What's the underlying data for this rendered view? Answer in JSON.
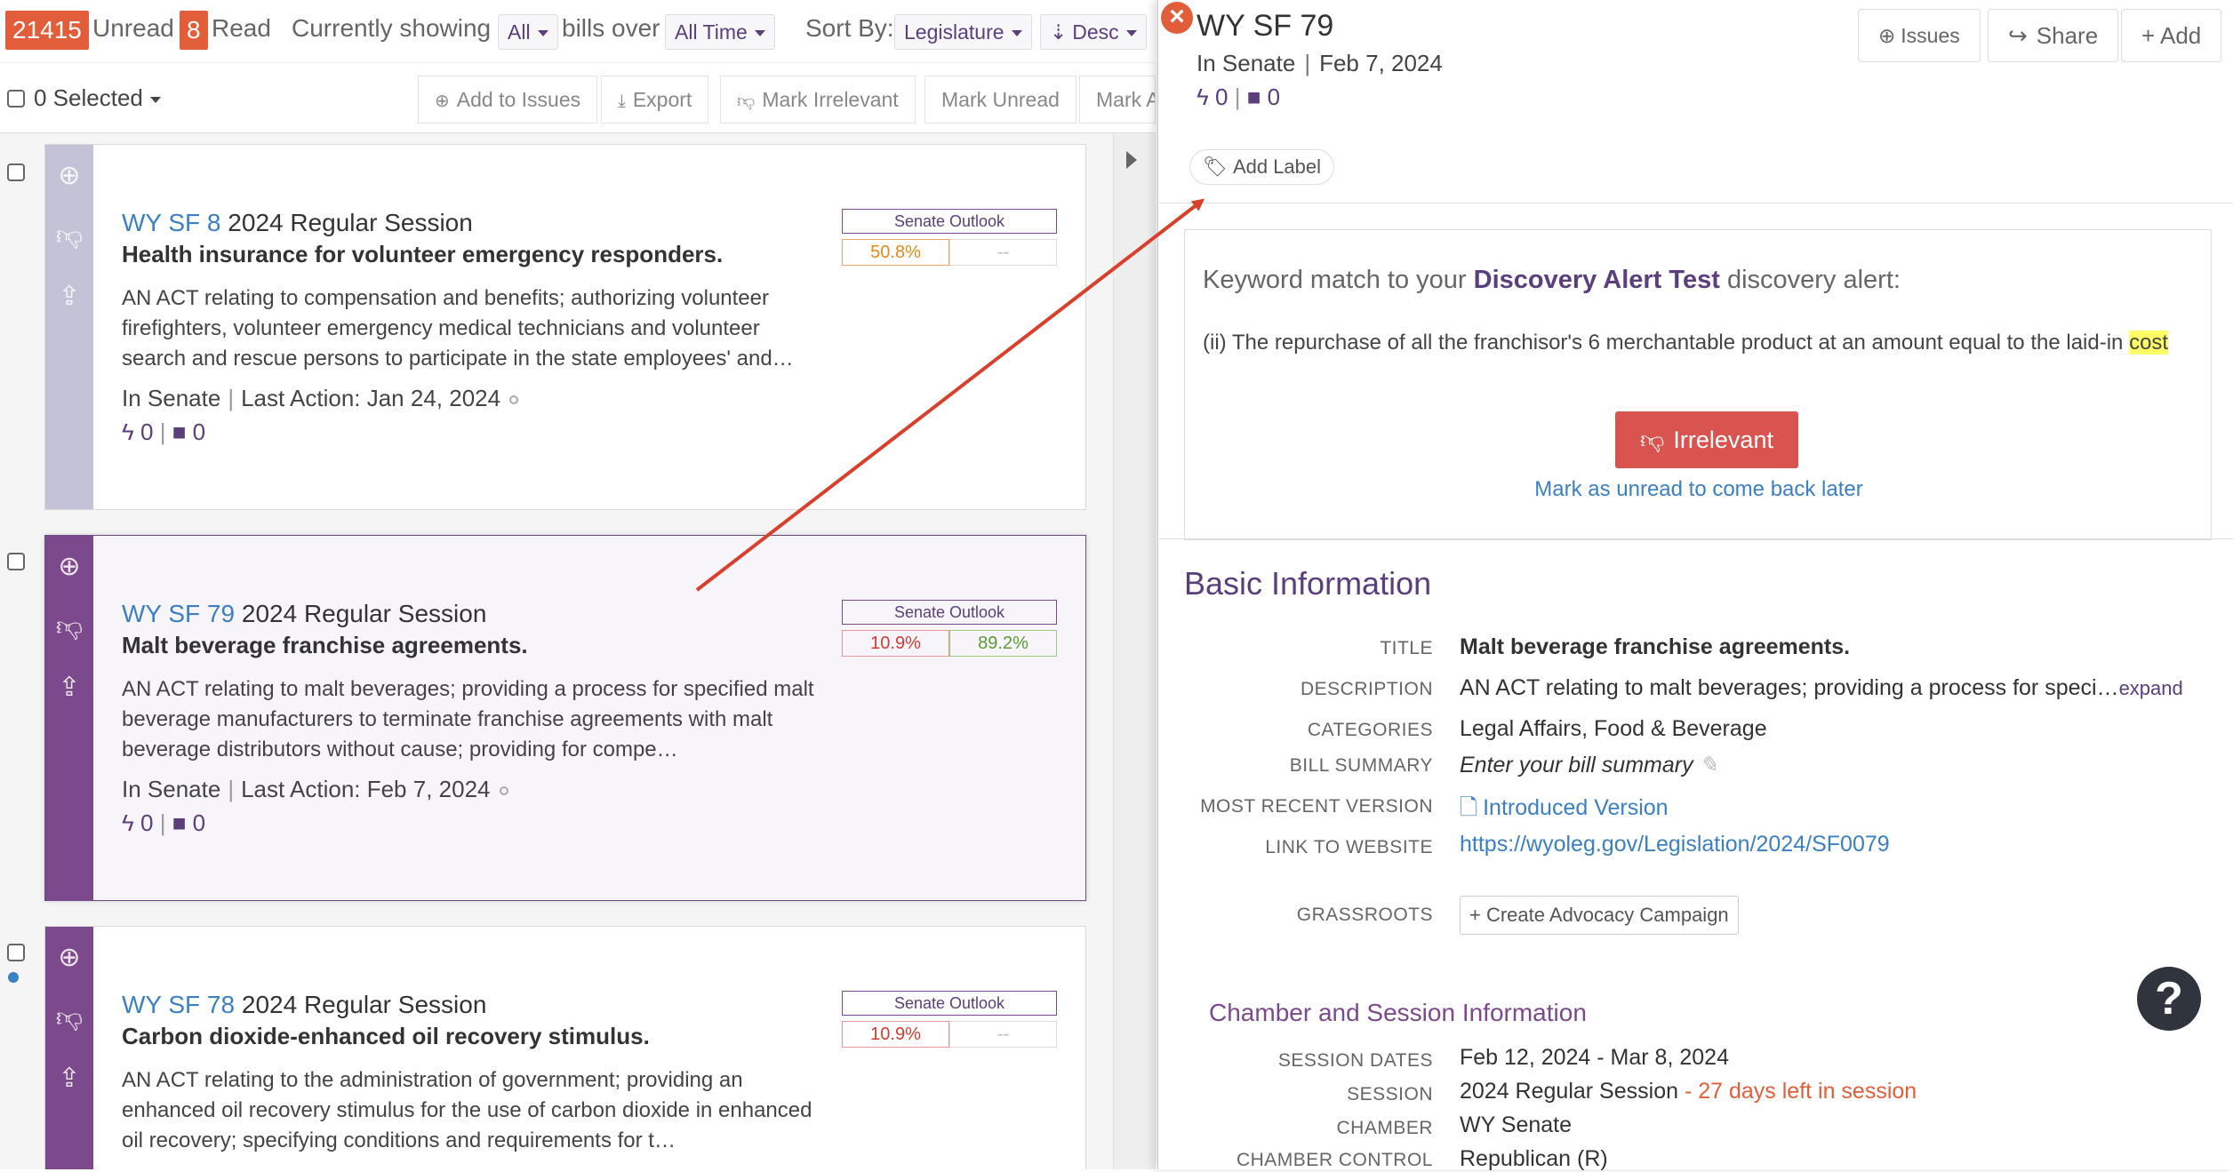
{
  "topbar": {
    "unread_count": "21415",
    "unread_label": "Unread",
    "read_count": "8",
    "read_label": "Read",
    "showing_label": "Currently showing",
    "filter_value": "All",
    "bills_over_label": "bills over",
    "time_value": "All Time",
    "sort_label": "Sort By:",
    "sort_value": "Legislature",
    "order_value": "Desc"
  },
  "actionbar": {
    "selected_label": "0 Selected",
    "add_to_issues": "Add to Issues",
    "export": "Export",
    "mark_irrelevant": "Mark Irrelevant",
    "mark_unread": "Mark Unread",
    "mark_more": "Mark A"
  },
  "bills": [
    {
      "number": "WY SF 8",
      "session": "2024 Regular Session",
      "title": "Health insurance for volunteer emergency responders.",
      "description": "AN ACT relating to compensation and benefits; authorizing volunteer firefighters, volunteer emergency medical technicians and volunteer search and rescue persons to participate in the state employees' and…",
      "status": "In Senate",
      "last_action": "Last Action: Jan 24, 2024",
      "activity": "0",
      "notes": "0",
      "outlook_label": "Senate Outlook",
      "outlook_pass": "50.8%",
      "outlook_fail": "--"
    },
    {
      "number": "WY SF 79",
      "session": "2024 Regular Session",
      "title": "Malt beverage franchise agreements.",
      "description": "AN ACT relating to malt beverages; providing a process for specified malt beverage manufacturers to terminate franchise agreements with malt beverage distributors without cause; providing for compe…",
      "status": "In Senate",
      "last_action": "Last Action: Feb 7, 2024",
      "activity": "0",
      "notes": "0",
      "outlook_label": "Senate Outlook",
      "outlook_pass": "10.9%",
      "outlook_fail": "89.2%"
    },
    {
      "number": "WY SF 78",
      "session": "2024 Regular Session",
      "title": "Carbon dioxide-enhanced oil recovery stimulus.",
      "description": "AN ACT relating to the administration of government; providing an enhanced oil recovery stimulus for the use of carbon dioxide in enhanced oil recovery; specifying conditions and requirements for t…",
      "status": "",
      "last_action": "",
      "activity": "",
      "notes": "",
      "outlook_label": "Senate Outlook",
      "outlook_pass": "10.9%",
      "outlook_fail": "--"
    }
  ],
  "panel": {
    "title": "WY SF 79",
    "status": "In Senate",
    "date": "Feb 7, 2024",
    "activity": "0",
    "notes": "0",
    "issues_btn": "Issues",
    "share_btn": "Share",
    "add_btn": "+ Add",
    "add_label": "Add Label",
    "match": {
      "prefix": "Keyword match to your",
      "alert_name": "Discovery Alert Test",
      "suffix": "discovery alert:",
      "text": "(ii) The repurchase of all the franchisor's 6 merchantable product at an amount equal to the laid-in",
      "highlight": "cost",
      "irrelevant_btn": "Irrelevant",
      "unread_link": "Mark as unread to come back later"
    },
    "basic_heading": "Basic Information",
    "fields": {
      "title_key": "TITLE",
      "title_val": "Malt beverage franchise agreements.",
      "desc_key": "DESCRIPTION",
      "desc_val": "AN ACT relating to malt beverages; providing a process for speci…",
      "expand": "expand",
      "cat_key": "CATEGORIES",
      "cat_val": "Legal Affairs, Food & Beverage",
      "summary_key": "BILL SUMMARY",
      "summary_val": "Enter your bill summary",
      "version_key": "MOST RECENT VERSION",
      "version_val": "Introduced Version",
      "link_key": "LINK TO WEBSITE",
      "link_val": "https://wyoleg.gov/Legislation/2024/SF0079",
      "grass_key": "GRASSROOTS",
      "grass_val": "+ Create Advocacy Campaign"
    },
    "chamber_heading": "Chamber and Session Information",
    "chamber": {
      "dates_key": "SESSION DATES",
      "dates_val": "Feb 12, 2024 - Mar 8, 2024",
      "session_key": "SESSION",
      "session_val": "2024 Regular Session",
      "days_left": "- 27 days left in session",
      "chamber_key": "CHAMBER",
      "chamber_val": "WY Senate",
      "control_key": "CHAMBER CONTROL",
      "control_val": "Republican (R)"
    },
    "help": "?"
  },
  "colors": {
    "brand_purple": "#5b3f7d",
    "unread_badge": "#e25d3a",
    "link_blue": "#3b7fc4",
    "irrelevant_red": "#d9534f",
    "highlight_yellow": "#ffff66"
  }
}
